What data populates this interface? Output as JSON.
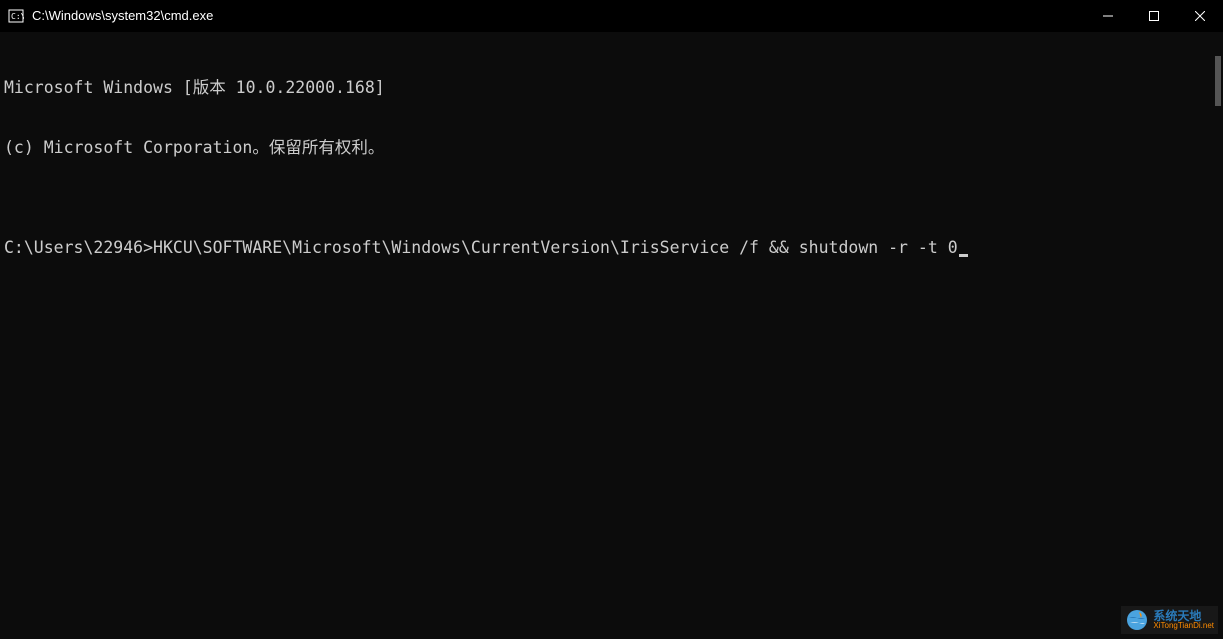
{
  "window": {
    "title": "C:\\Windows\\system32\\cmd.exe"
  },
  "terminal": {
    "line1": "Microsoft Windows [版本 10.0.22000.168]",
    "line2": "(c) Microsoft Corporation。保留所有权利。",
    "line3": "",
    "prompt": "C:\\Users\\22946>",
    "command": "HKCU\\SOFTWARE\\Microsoft\\Windows\\CurrentVersion\\IrisService /f && shutdown -r -t 0"
  },
  "watermark": {
    "title": "系统天地",
    "sub": "XiTongTianDi.net"
  }
}
